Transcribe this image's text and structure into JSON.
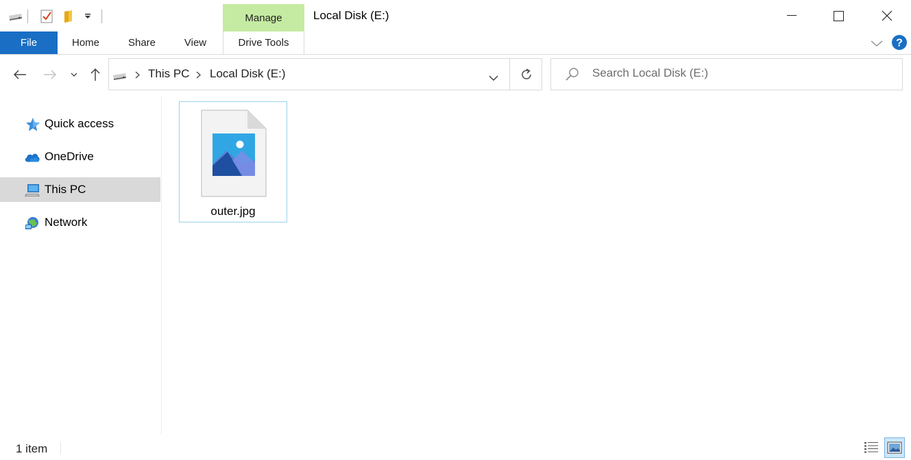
{
  "window": {
    "title": "Local Disk (E:)",
    "contextual_tab": "Manage"
  },
  "quick_access_toolbar": {
    "icons": [
      "drive-icon",
      "properties-icon",
      "new-folder-icon",
      "customize-dropdown-icon"
    ]
  },
  "ribbon": {
    "tabs": [
      {
        "label": "File"
      },
      {
        "label": "Home"
      },
      {
        "label": "Share"
      },
      {
        "label": "View"
      },
      {
        "label": "Drive Tools"
      }
    ],
    "accent": "#1a6fc4",
    "contextual_accent": "#c5eba2"
  },
  "address_bar": {
    "breadcrumb": [
      "This PC",
      "Local Disk (E:)"
    ]
  },
  "search": {
    "placeholder": "Search Local Disk (E:)"
  },
  "sidebar": {
    "items": [
      {
        "label": "Quick access",
        "icon": "star-icon",
        "selected": false
      },
      {
        "label": "OneDrive",
        "icon": "cloud-icon",
        "selected": false
      },
      {
        "label": "This PC",
        "icon": "computer-icon",
        "selected": true
      },
      {
        "label": "Network",
        "icon": "network-icon",
        "selected": false
      }
    ]
  },
  "files": [
    {
      "name": "outer.jpg",
      "icon": "image-file-icon"
    }
  ],
  "status": {
    "item_count": "1 item"
  }
}
